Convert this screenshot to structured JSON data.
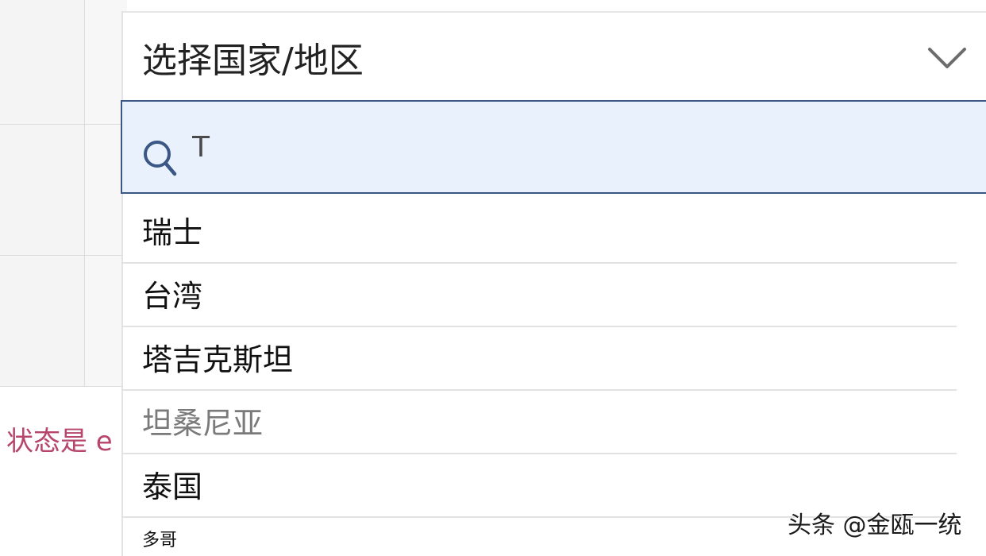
{
  "background": {
    "status_text": "状态是 e"
  },
  "select": {
    "label": "选择国家/地区",
    "chevron_icon": "chevron-down-icon"
  },
  "search": {
    "value": "T",
    "icon": "search-icon"
  },
  "options": [
    "瑞士",
    "台湾",
    "塔吉克斯坦",
    "坦桑尼亚",
    "泰国",
    "多哥"
  ],
  "watermark": "头条 @金瓯一统",
  "colors": {
    "search_bg": "#e8f1fc",
    "search_border": "#3a5786",
    "status_text": "#b6466b"
  }
}
